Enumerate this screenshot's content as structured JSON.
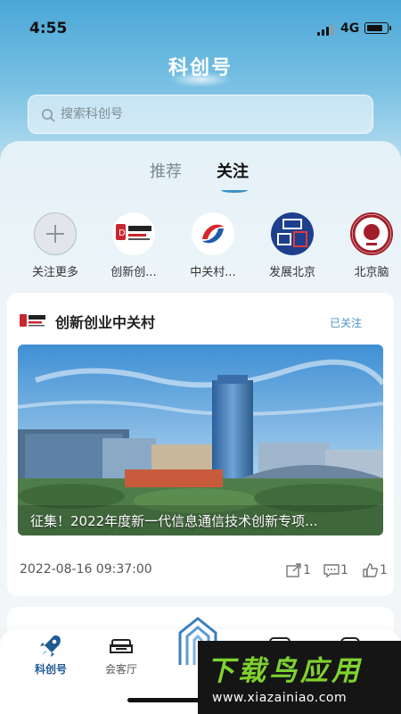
{
  "status_bar": {
    "time": "4:55",
    "network": "4G",
    "signal_bars": 4,
    "battery_level": 0.85,
    "icons": [
      "signal-icon",
      "battery-icon"
    ]
  },
  "header": {
    "title": "科创号",
    "search_placeholder": "搜索科创号"
  },
  "tabs": [
    {
      "label": "推荐",
      "active": false
    },
    {
      "label": "关注",
      "active": true
    }
  ],
  "follow_row": [
    {
      "label": "关注更多",
      "icon": "plus-icon"
    },
    {
      "label": "创新创...",
      "icon": "zhongguancun-logo"
    },
    {
      "label": "中关村...",
      "icon": "zgc-brand-logo"
    },
    {
      "label": "发展北京",
      "icon": "develop-beijing-logo"
    },
    {
      "label": "北京脑",
      "icon": "beijing-brain-logo"
    }
  ],
  "feed": {
    "account_name": "创新创业中关村",
    "follow_status": "已关注",
    "caption": "征集！2022年度新一代信息通信技术创新专项...",
    "date": "2022-08-16 09:37:00",
    "stats": {
      "shares": "1",
      "comments": "1",
      "likes": "1"
    }
  },
  "bottom_nav": [
    {
      "label": "科创号",
      "icon": "rocket-icon",
      "active": true
    },
    {
      "label": "会客厅",
      "icon": "sofa-icon",
      "active": false
    }
  ],
  "watermark": {
    "text": "下载鸟应用",
    "url": "www.xiazainiao.com"
  },
  "colors": {
    "accent": "#1e5a96",
    "link": "#4a95c8",
    "tab_underline": "#3a8fc6",
    "watermark_green": "#7fd22f"
  }
}
